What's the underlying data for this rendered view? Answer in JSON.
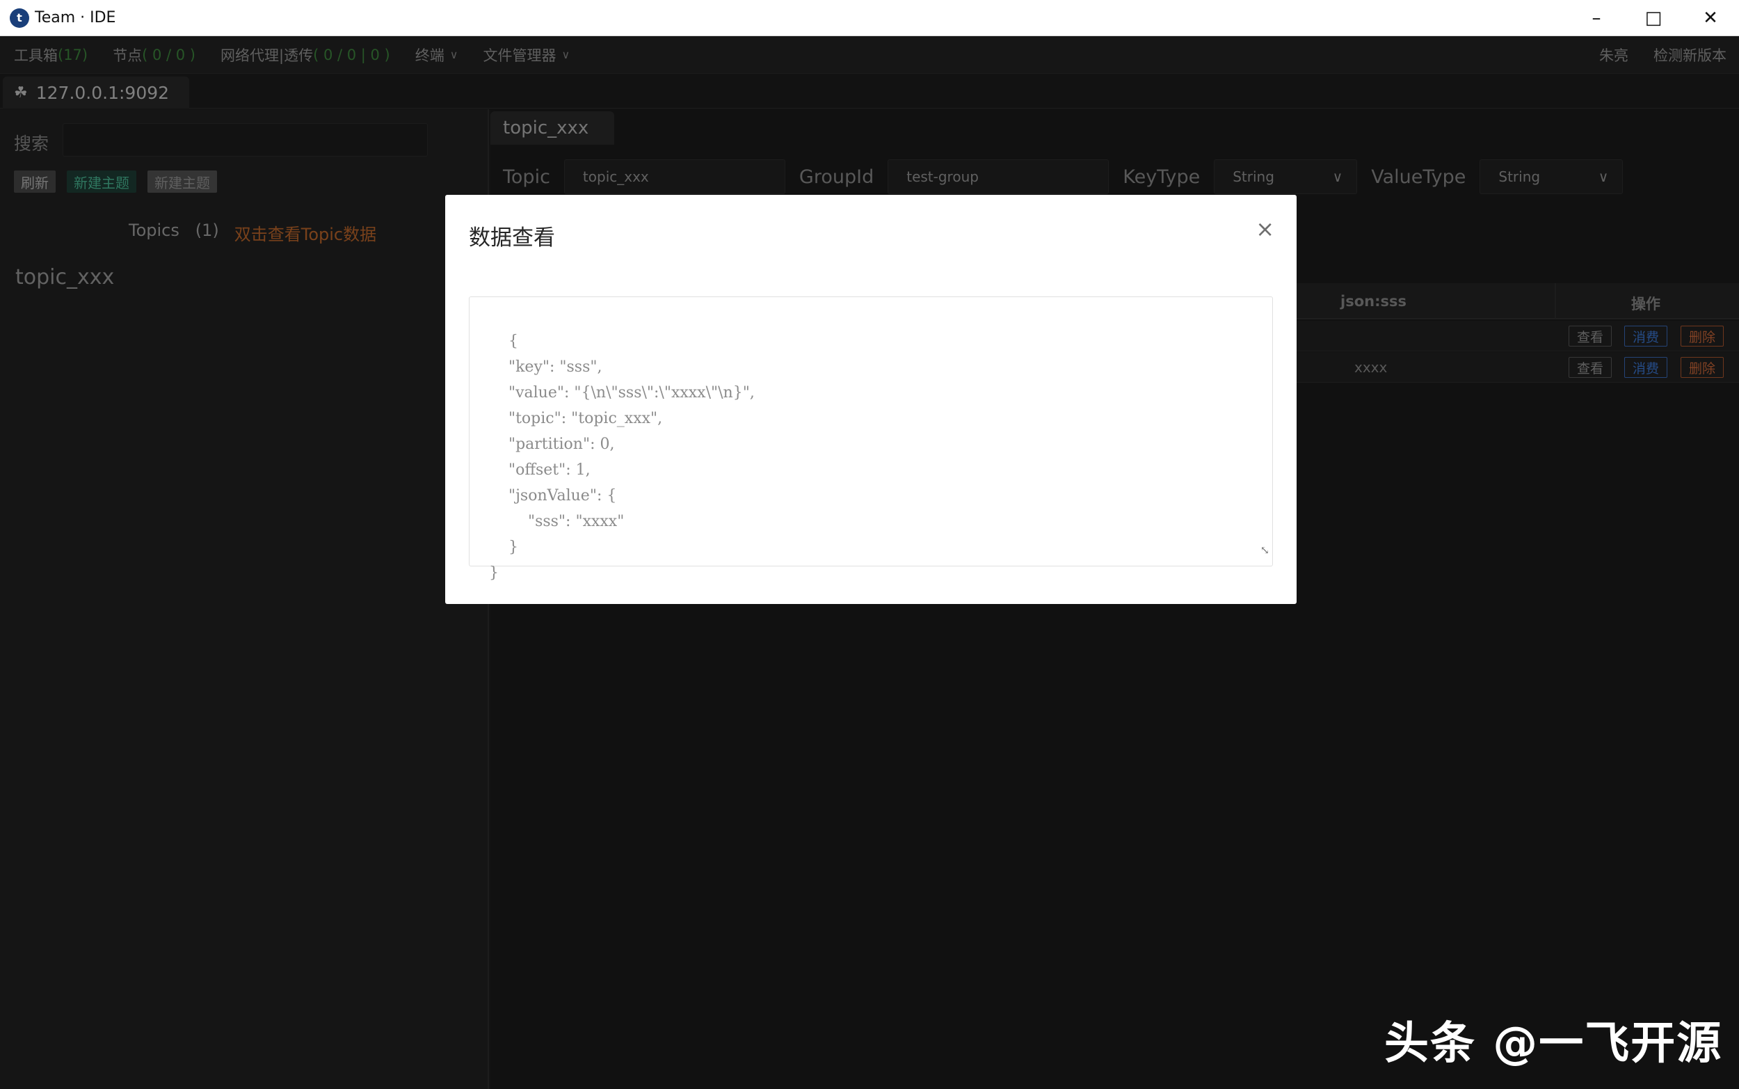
{
  "window": {
    "title": "Team · IDE",
    "logo_char": "t"
  },
  "menu": {
    "toolbox_label": "工具箱",
    "toolbox_count": "(17)",
    "nodes_label": "节点",
    "nodes_count": "( 0 / 0 )",
    "proxy_label": "网络代理|透传",
    "proxy_count": "( 0 / 0 | 0 )",
    "terminal_label": "终端",
    "filemgr_label": "文件管理器",
    "user_label": "朱亮",
    "check_version_label": "检测新版本"
  },
  "connection": {
    "tab_label": "127.0.0.1:9092"
  },
  "left": {
    "search_label": "搜索",
    "search_value": "",
    "btn_refresh": "刷新",
    "btn_new_topic": "新建主题",
    "btn_new_topic_2": "新建主题",
    "topics_label": "Topics",
    "topics_count": "(1)",
    "topics_hint": "双击查看Topic数据",
    "topics": [
      "topic_xxx"
    ]
  },
  "right": {
    "active_tab": "topic_xxx",
    "form": {
      "topic_label": "Topic",
      "topic_value": "topic_xxx",
      "groupid_label": "GroupId",
      "groupid_value": "test-group",
      "keytype_label": "KeyType",
      "keytype_value": "String",
      "valuetype_label": "ValueType",
      "valuetype_value": "String"
    },
    "table": {
      "headers": {
        "json_col": "json:sss",
        "actions_col": "操作"
      },
      "rows": [
        {
          "json_sss": "",
          "view": "查看",
          "consume": "消费",
          "delete": "删除"
        },
        {
          "json_sss": "xxxx",
          "view": "查看",
          "consume": "消费",
          "delete": "删除"
        }
      ]
    }
  },
  "modal": {
    "title": "数据查看",
    "close_symbol": "×",
    "json_text": "{\n    \"key\": \"sss\",\n    \"value\": \"{\\n\\\"sss\\\":\\\"xxxx\\\"\\n}\",\n    \"topic\": \"topic_xxx\",\n    \"partition\": 0,\n    \"offset\": 1,\n    \"jsonValue\": {\n        \"sss\": \"xxxx\"\n    }\n}"
  },
  "watermark": {
    "text": "头条 @一飞开源"
  },
  "colors": {
    "accent_green": "#3f8a3f",
    "hint_orange": "#c46a2c",
    "consume_blue": "#3d7ad8",
    "delete_orange": "#d06a3a"
  }
}
